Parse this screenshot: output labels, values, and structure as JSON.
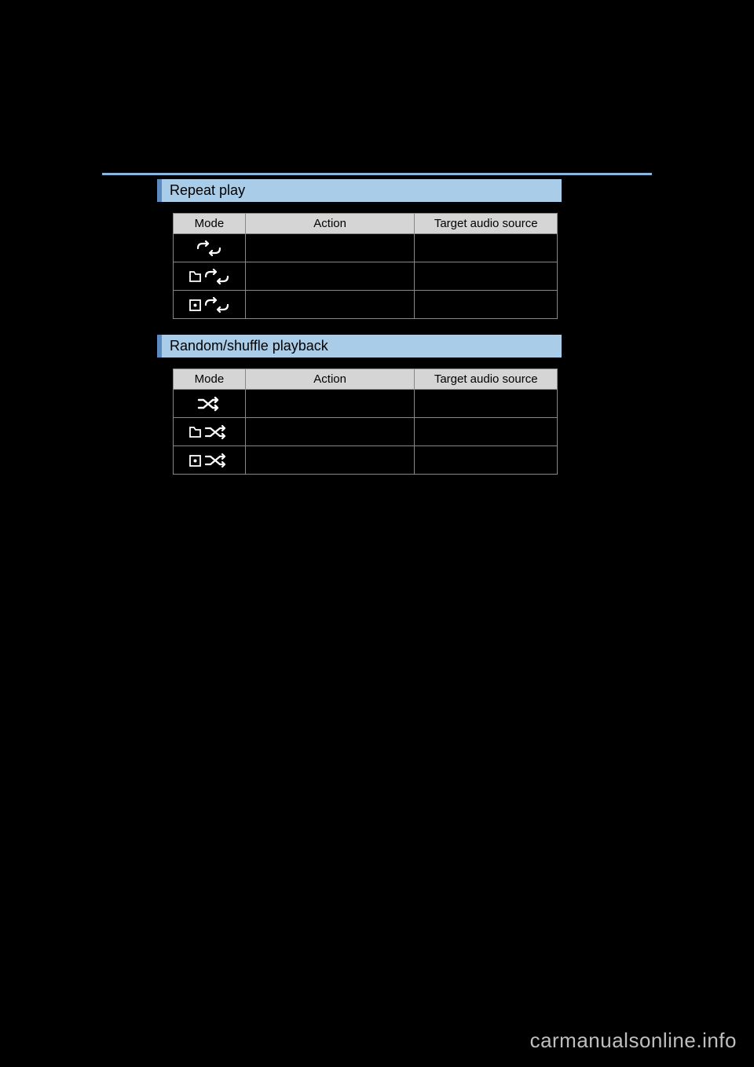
{
  "sections": [
    {
      "title": "Repeat play",
      "headers": {
        "mode": "Mode",
        "action": "Action",
        "target": "Target audio source"
      }
    },
    {
      "title": "Random/shuffle playback",
      "headers": {
        "mode": "Mode",
        "action": "Action",
        "target": "Target audio source"
      }
    }
  ],
  "watermark": "carmanualsonline.info"
}
